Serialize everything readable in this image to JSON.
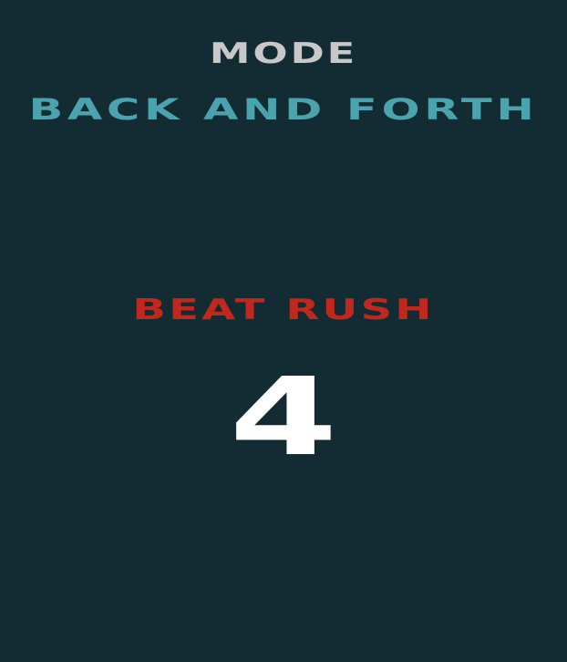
{
  "header": {
    "mode_label": "MODE",
    "mode_value": "BACK AND FORTH"
  },
  "game": {
    "title": "BEAT RUSH",
    "countdown": "4"
  },
  "colors": {
    "background": "#132c33",
    "mode_label": "#c8c8c8",
    "mode_value": "#4aa3ad",
    "title": "#c0281e",
    "countdown": "#ffffff"
  }
}
